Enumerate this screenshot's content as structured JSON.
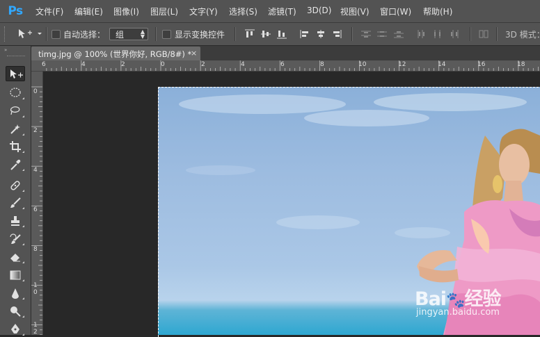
{
  "app": {
    "logo": "Ps"
  },
  "menu": [
    "文件(F)",
    "编辑(E)",
    "图像(I)",
    "图层(L)",
    "文字(Y)",
    "选择(S)",
    "滤镜(T)",
    "3D(D)",
    "视图(V)",
    "窗口(W)",
    "帮助(H)"
  ],
  "options": {
    "tool_preset_icon": "move-tool-icon",
    "auto_select_label": "自动选择：",
    "auto_select_checked": false,
    "auto_select_target": "组",
    "show_transform_label": "显示变换控件",
    "show_transform_checked": false,
    "mode_3d_label": "3D 模式："
  },
  "toolbar": {
    "header": "»",
    "tools": [
      "move-tool",
      "elliptical-marquee-tool",
      "lasso-tool",
      "magic-wand-tool",
      "crop-tool",
      "eyedropper-tool",
      "spot-healing-brush-tool",
      "brush-tool",
      "clone-stamp-tool",
      "history-brush-tool",
      "eraser-tool",
      "gradient-tool",
      "blur-tool",
      "dodge-tool",
      "pen-tool"
    ],
    "active_tool": "move-tool"
  },
  "document": {
    "tab_title": "timg.jpg @ 100% (世界你好, RGB/8#) *",
    "close_glyph": "×"
  },
  "ruler": {
    "horizontal_labels": [
      "6",
      "4",
      "2",
      "0",
      "2",
      "4",
      "6",
      "8",
      "10",
      "12",
      "14",
      "16",
      "18"
    ],
    "vertical_labels": [
      "0",
      "2",
      "4",
      "6",
      "8",
      "1 0",
      "1 2"
    ]
  },
  "watermark": {
    "brand": "Bai",
    "brand_suffix": "经验",
    "url": "jingyan.baidu.com"
  },
  "colors": {
    "ui_dark": "#535353",
    "pasteboard": "#282828",
    "ps_blue": "#31a8ff",
    "sky": "#9dbce0",
    "sea": "#2ea7d1"
  }
}
